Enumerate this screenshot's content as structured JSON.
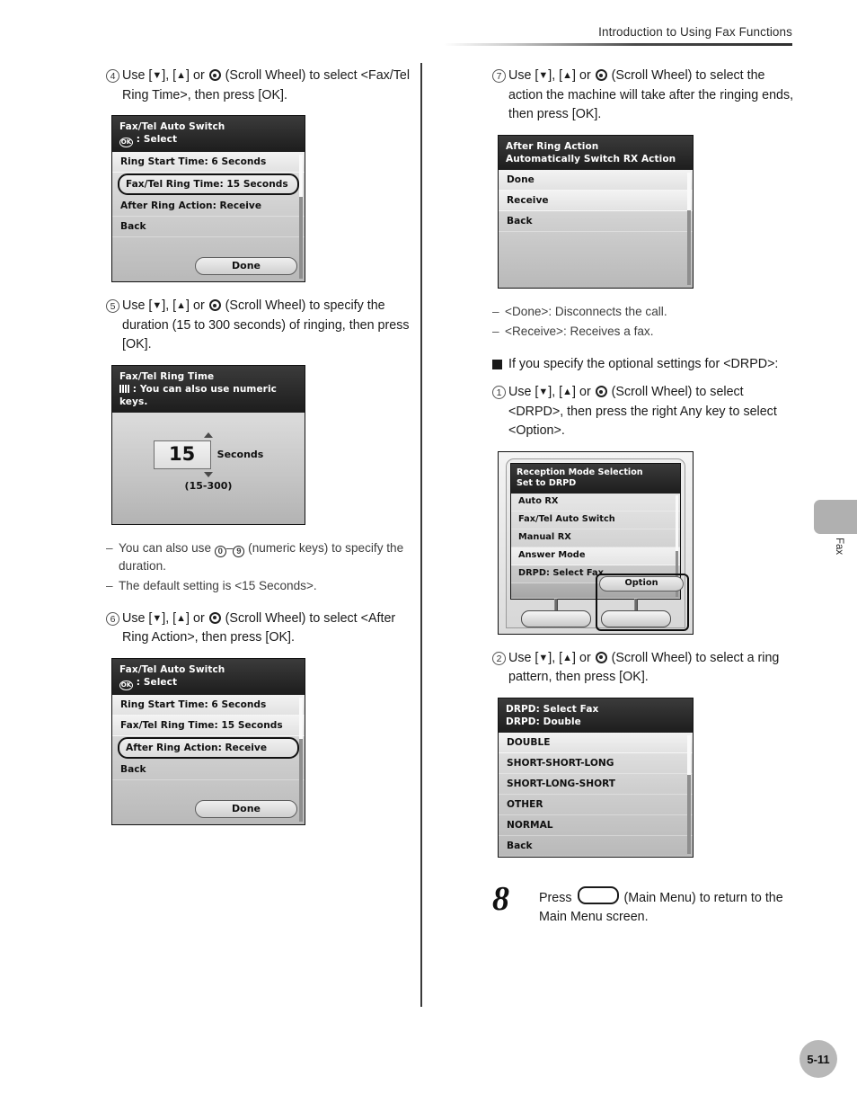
{
  "header": {
    "running_head": "Introduction to Using Fax Functions"
  },
  "page_number": "5-11",
  "side_tab": {
    "label": "Fax"
  },
  "left_column": {
    "step4": {
      "number": "4",
      "text_before": "Use [",
      "text_mid": "], [",
      "text_after": "] or ",
      "text_tail": " (Scroll Wheel) to select <Fax/Tel Ring Time>, then press [OK]."
    },
    "screen1": {
      "title": "Fax/Tel Auto Switch",
      "subtitle": ": Select",
      "rows": [
        {
          "label": "Ring Start Time: 6 Seconds",
          "state": "light"
        },
        {
          "label": "Fax/Tel Ring Time: 15 Seconds",
          "state": "outlined"
        },
        {
          "label": "After Ring Action: Receive",
          "state": "plain"
        },
        {
          "label": "Back",
          "state": "plain"
        }
      ],
      "done_label": "Done"
    },
    "step5": {
      "number": "5",
      "text_tail": " (Scroll Wheel) to specify the duration (15 to 300 seconds) of ringing, then press [OK]."
    },
    "screen2": {
      "title": "Fax/Tel Ring Time",
      "subtitle": ": You can also use numeric keys.",
      "value": "15",
      "unit": "Seconds",
      "range": "(15-300)"
    },
    "notes": [
      {
        "key_low": "0",
        "key_high": "9",
        "text_pre": "You can also use ",
        "text_post": " (numeric keys) to specify the duration."
      },
      {
        "text": "The default setting is <15 Seconds>."
      }
    ],
    "step6": {
      "number": "6",
      "text_tail": " (Scroll Wheel) to select <After Ring Action>, then press [OK]."
    },
    "screen3": {
      "title": "Fax/Tel Auto Switch",
      "subtitle": ": Select",
      "rows": [
        {
          "label": "Ring Start Time: 6 Seconds",
          "state": "light"
        },
        {
          "label": "Fax/Tel Ring Time: 15 Seconds",
          "state": "light"
        },
        {
          "label": "After Ring Action: Receive",
          "state": "outlined"
        },
        {
          "label": "Back",
          "state": "plain"
        }
      ],
      "done_label": "Done"
    }
  },
  "right_column": {
    "step7": {
      "number": "7",
      "text_tail": " (Scroll Wheel) to select the action the machine will take after the ringing ends, then press [OK]."
    },
    "screen4": {
      "title": "After Ring Action",
      "subtitle": "Automatically Switch RX Action",
      "rows": [
        {
          "label": "Done",
          "state": "light"
        },
        {
          "label": "Receive",
          "state": "light"
        },
        {
          "label": "Back",
          "state": "plain"
        }
      ]
    },
    "notes": [
      {
        "text": "<Done>: Disconnects the call."
      },
      {
        "text": "<Receive>: Receives a fax."
      }
    ],
    "bullet_head": "If you specify the optional settings for <DRPD>:",
    "step1": {
      "number": "1",
      "text_tail": " (Scroll Wheel) to select <DRPD>, then press the right Any key to select <Option>."
    },
    "device_screen": {
      "title": "Reception Mode Selection",
      "subtitle": "Set to DRPD",
      "rows": [
        {
          "label": "Auto RX",
          "state": "plain"
        },
        {
          "label": "Fax/Tel Auto Switch",
          "state": "plain"
        },
        {
          "label": "Manual RX",
          "state": "plain"
        },
        {
          "label": "Answer Mode",
          "state": "sel"
        },
        {
          "label": "DRPD: Select Fax",
          "state": "plain"
        }
      ],
      "option_label": "Option"
    },
    "step2": {
      "number": "2",
      "text_tail": " (Scroll Wheel) to select a ring pattern, then press [OK]."
    },
    "screen5": {
      "title": "DRPD: Select Fax",
      "subtitle": "DRPD: Double",
      "rows": [
        {
          "label": "DOUBLE",
          "state": "light"
        },
        {
          "label": "SHORT-SHORT-LONG",
          "state": "plain"
        },
        {
          "label": "SHORT-LONG-SHORT",
          "state": "plain"
        },
        {
          "label": "OTHER",
          "state": "plain"
        },
        {
          "label": "NORMAL",
          "state": "plain"
        },
        {
          "label": "Back",
          "state": "plain"
        }
      ]
    },
    "big_step": {
      "number": "8",
      "text_pre": "Press ",
      "text_post": " (Main Menu) to return to the Main Menu screen."
    }
  },
  "glyphs": {
    "down_arrow": "▼",
    "up_arrow": "▲",
    "ok_key": "OK",
    "dash": "–"
  }
}
